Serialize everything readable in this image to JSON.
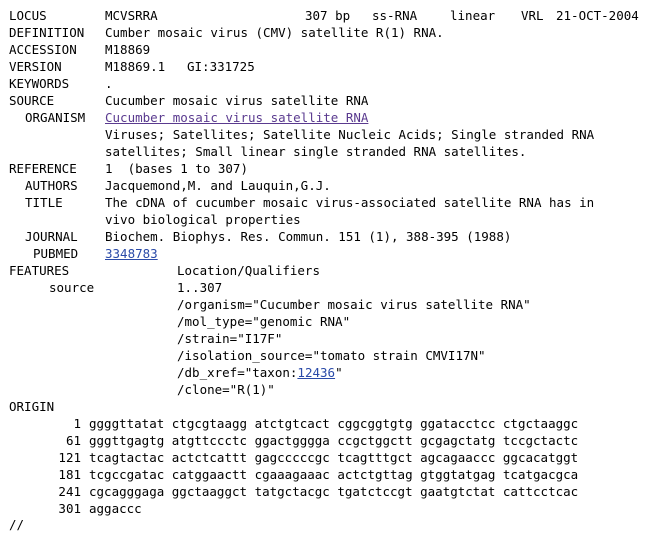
{
  "locus": {
    "label": "LOCUS",
    "name": "MCVSRRA",
    "length": "307 bp",
    "moltype": "ss-RNA",
    "topology": "linear",
    "division": "VRL",
    "date": "21-OCT-2004"
  },
  "definition": {
    "label": "DEFINITION",
    "text": "Cumber mosaic virus (CMV) satellite R(1) RNA."
  },
  "accession": {
    "label": "ACCESSION",
    "value": "M18869"
  },
  "version": {
    "label": "VERSION",
    "value": "M18869.1",
    "gi": "GI:331725"
  },
  "keywords": {
    "label": "KEYWORDS",
    "value": "."
  },
  "source": {
    "label": "SOURCE",
    "value": "Cucumber mosaic virus satellite RNA",
    "organism_label": "ORGANISM",
    "organism_link": "Cucumber mosaic virus satellite RNA",
    "lineage": [
      "Viruses; Satellites; Satellite Nucleic Acids; Single stranded RNA",
      "satellites; Small linear single stranded RNA satellites."
    ]
  },
  "reference": {
    "label": "REFERENCE",
    "value": "1  (bases 1 to 307)",
    "authors_label": "AUTHORS",
    "authors": "Jacquemond,M. and Lauquin,G.J.",
    "title_label": "TITLE",
    "title": [
      "The cDNA of cucumber mosaic virus-associated satellite RNA has in",
      "vivo biological properties"
    ],
    "journal_label": "JOURNAL",
    "journal": "Biochem. Biophys. Res. Commun. 151 (1), 388-395 (1988)",
    "pubmed_label": "PUBMED",
    "pubmed_link": "3348783"
  },
  "features": {
    "label": "FEATURES",
    "header": "Location/Qualifiers",
    "key": "source",
    "location": "1..307",
    "qualifiers": [
      "/organism=\"Cucumber mosaic virus satellite RNA\"",
      "/mol_type=\"genomic RNA\"",
      "/strain=\"I17F\"",
      "/isolation_source=\"tomato strain CMVI17N\""
    ],
    "db_xref_prefix": "/db_xref=\"taxon:",
    "db_xref_link": "12436",
    "db_xref_suffix": "\"",
    "clone": "/clone=\"R(1)\""
  },
  "origin": {
    "label": "ORIGIN",
    "lines": [
      {
        "n": "1",
        "seq": "ggggttatat ctgcgtaagg atctgtcact cggcggtgtg ggatacctcc ctgctaaggc"
      },
      {
        "n": "61",
        "seq": "gggttgagtg atgttccctc ggactgggga ccgctggctt gcgagctatg tccgctactc"
      },
      {
        "n": "121",
        "seq": "tcagtactac actctcattt gagcccccgc tcagtttgct agcagaaccc ggcacatggt"
      },
      {
        "n": "181",
        "seq": "tcgccgatac catggaactt cgaaagaaac actctgttag gtggtatgag tcatgacgca"
      },
      {
        "n": "241",
        "seq": "cgcagggaga ggctaaggct tatgctacgc tgatctccgt gaatgtctat cattcctcac"
      },
      {
        "n": "301",
        "seq": "aggaccc"
      }
    ]
  },
  "terminator": "//"
}
